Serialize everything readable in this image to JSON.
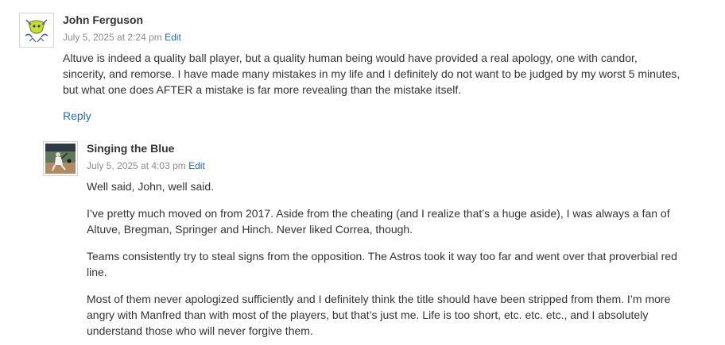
{
  "comments": [
    {
      "author": "John Ferguson",
      "date": "July 5, 2025 at 2:24 pm",
      "edit_label": "Edit",
      "avatar_icon": "identicon-avatar-icon",
      "paragraphs": [
        "Altuve is indeed a quality ball player, but a quality human being would have provided a real apology, one with candor, sincerity, and remorse. I have made many mistakes in my life and I definitely do not want to be judged by my worst 5 minutes, but what one does AFTER a mistake is far more revealing than the mistake itself."
      ],
      "reply_label": "Reply"
    },
    {
      "author": "Singing the Blue",
      "date": "July 5, 2025 at 4:03 pm",
      "edit_label": "Edit",
      "avatar_icon": "baseball-photo-avatar-icon",
      "paragraphs": [
        "Well said, John, well said.",
        "I’ve pretty much moved on from 2017. Aside from the cheating (and I realize that’s a huge aside), I was always a fan of Altuve, Bregman, Springer and Hinch. Never liked Correa, though.",
        "Teams consistently try to steal signs from the opposition. The Astros took it way too far and went over that proverbial red line.",
        "Most of them never apologized sufficiently and I definitely think the title should have been stripped from them. I’m more angry with Manfred than with most of the players, but that’s just me. Life is too short, etc. etc. etc., and I absolutely understand those who will never forgive them."
      ]
    }
  ],
  "colors": {
    "link": "#1e6bb8",
    "meta": "#8c8c8c",
    "text": "#333333"
  }
}
